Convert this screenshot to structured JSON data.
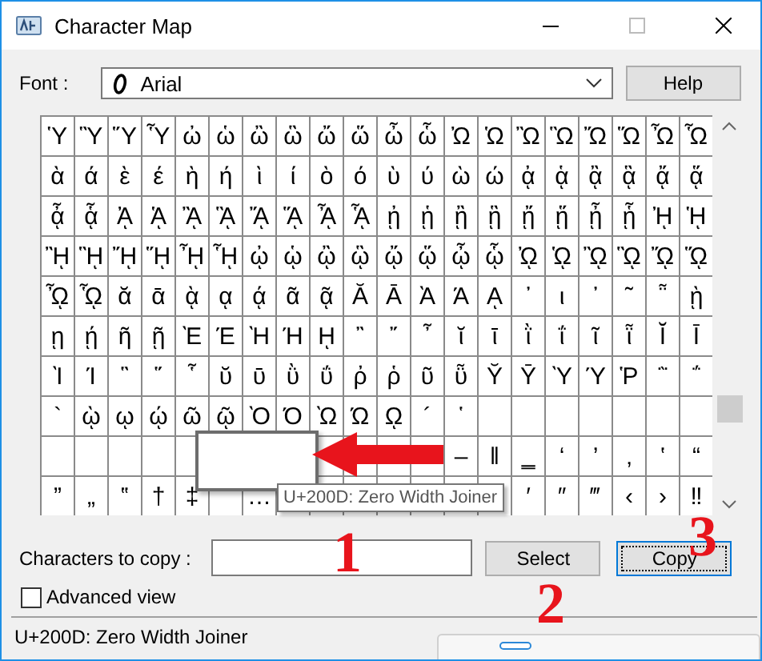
{
  "window": {
    "title": "Character Map"
  },
  "font": {
    "label": "Font :",
    "value": "Arial"
  },
  "help_button": {
    "label": "Help"
  },
  "grid": {
    "rows": [
      [
        "Ὑ",
        "Ὓ",
        "Ὕ",
        "Ὗ",
        "ὠ",
        "ὡ",
        "ὢ",
        "ὣ",
        "ὤ",
        "ὥ",
        "ὦ",
        "ὧ",
        "Ὠ",
        "Ὡ",
        "Ὢ",
        "Ὣ",
        "Ὤ",
        "Ὥ",
        "Ὦ",
        "Ὧ"
      ],
      [
        "ὰ",
        "ά",
        "ὲ",
        "έ",
        "ὴ",
        "ή",
        "ὶ",
        "ί",
        "ὸ",
        "ό",
        "ὺ",
        "ύ",
        "ὼ",
        "ώ",
        "ᾀ",
        "ᾁ",
        "ᾂ",
        "ᾃ",
        "ᾄ",
        "ᾅ"
      ],
      [
        "ᾆ",
        "ᾇ",
        "ᾈ",
        "ᾉ",
        "ᾊ",
        "ᾋ",
        "ᾌ",
        "ᾍ",
        "ᾎ",
        "ᾏ",
        "ᾐ",
        "ᾑ",
        "ᾒ",
        "ᾓ",
        "ᾔ",
        "ᾕ",
        "ᾖ",
        "ᾗ",
        "ᾘ",
        "ᾙ"
      ],
      [
        "ᾚ",
        "ᾛ",
        "ᾜ",
        "ᾝ",
        "ᾞ",
        "ᾟ",
        "ᾠ",
        "ᾡ",
        "ᾢ",
        "ᾣ",
        "ᾤ",
        "ᾥ",
        "ᾦ",
        "ᾧ",
        "ᾨ",
        "ᾩ",
        "ᾪ",
        "ᾫ",
        "ᾬ",
        "ᾭ"
      ],
      [
        "ᾮ",
        "ᾯ",
        "ᾰ",
        "ᾱ",
        "ᾲ",
        "ᾳ",
        "ᾴ",
        "ᾶ",
        "ᾷ",
        "Ᾰ",
        "Ᾱ",
        "Ὰ",
        "Ά",
        "ᾼ",
        "᾽",
        "ι",
        "᾿",
        "῀",
        "῁",
        "ῂ"
      ],
      [
        "ῃ",
        "ῄ",
        "ῆ",
        "ῇ",
        "Ὲ",
        "Έ",
        "Ὴ",
        "Ή",
        "ῌ",
        "῍",
        "῎",
        "῏",
        "ῐ",
        "ῑ",
        "ῒ",
        "ΐ",
        "ῖ",
        "ῗ",
        "Ῐ",
        "Ῑ"
      ],
      [
        "Ὶ",
        "Ί",
        "῝",
        "῞",
        "῟",
        "ῠ",
        "ῡ",
        "ῢ",
        "ΰ",
        "ῤ",
        "ῥ",
        "ῦ",
        "ῧ",
        "Ῠ",
        "Ῡ",
        "Ὺ",
        "Ύ",
        "Ῥ",
        "῭",
        "΅"
      ],
      [
        "`",
        "ῲ",
        "ῳ",
        "ῴ",
        "ῶ",
        "ῷ",
        "Ὸ",
        "Ό",
        "Ὼ",
        "Ώ",
        "ῼ",
        "´",
        "῾",
        null,
        null,
        null,
        null,
        null,
        null,
        null
      ],
      [
        null,
        null,
        null,
        null,
        null,
        null,
        null,
        null,
        null,
        null,
        null,
        null,
        "–",
        "‖",
        "‗",
        "‘",
        "’",
        "‚",
        "‛",
        "“"
      ],
      [
        "”",
        "„",
        "‟",
        "†",
        "‡",
        null,
        "…",
        null,
        null,
        null,
        null,
        null,
        null,
        null,
        "′",
        "″",
        "‴",
        "‹",
        "›",
        "‼"
      ]
    ]
  },
  "tooltip": "U+200D: Zero Width Joiner",
  "copy_field": {
    "label": "Characters to copy :"
  },
  "buttons": [
    {
      "label": "Select",
      "focused": false
    },
    {
      "label": "Copy",
      "focused": true
    }
  ],
  "advanced_view": {
    "label": "Advanced view",
    "checked": false
  },
  "status_bar": "U+200D: Zero Width Joiner",
  "annotations": [
    "1",
    "2",
    "3"
  ]
}
